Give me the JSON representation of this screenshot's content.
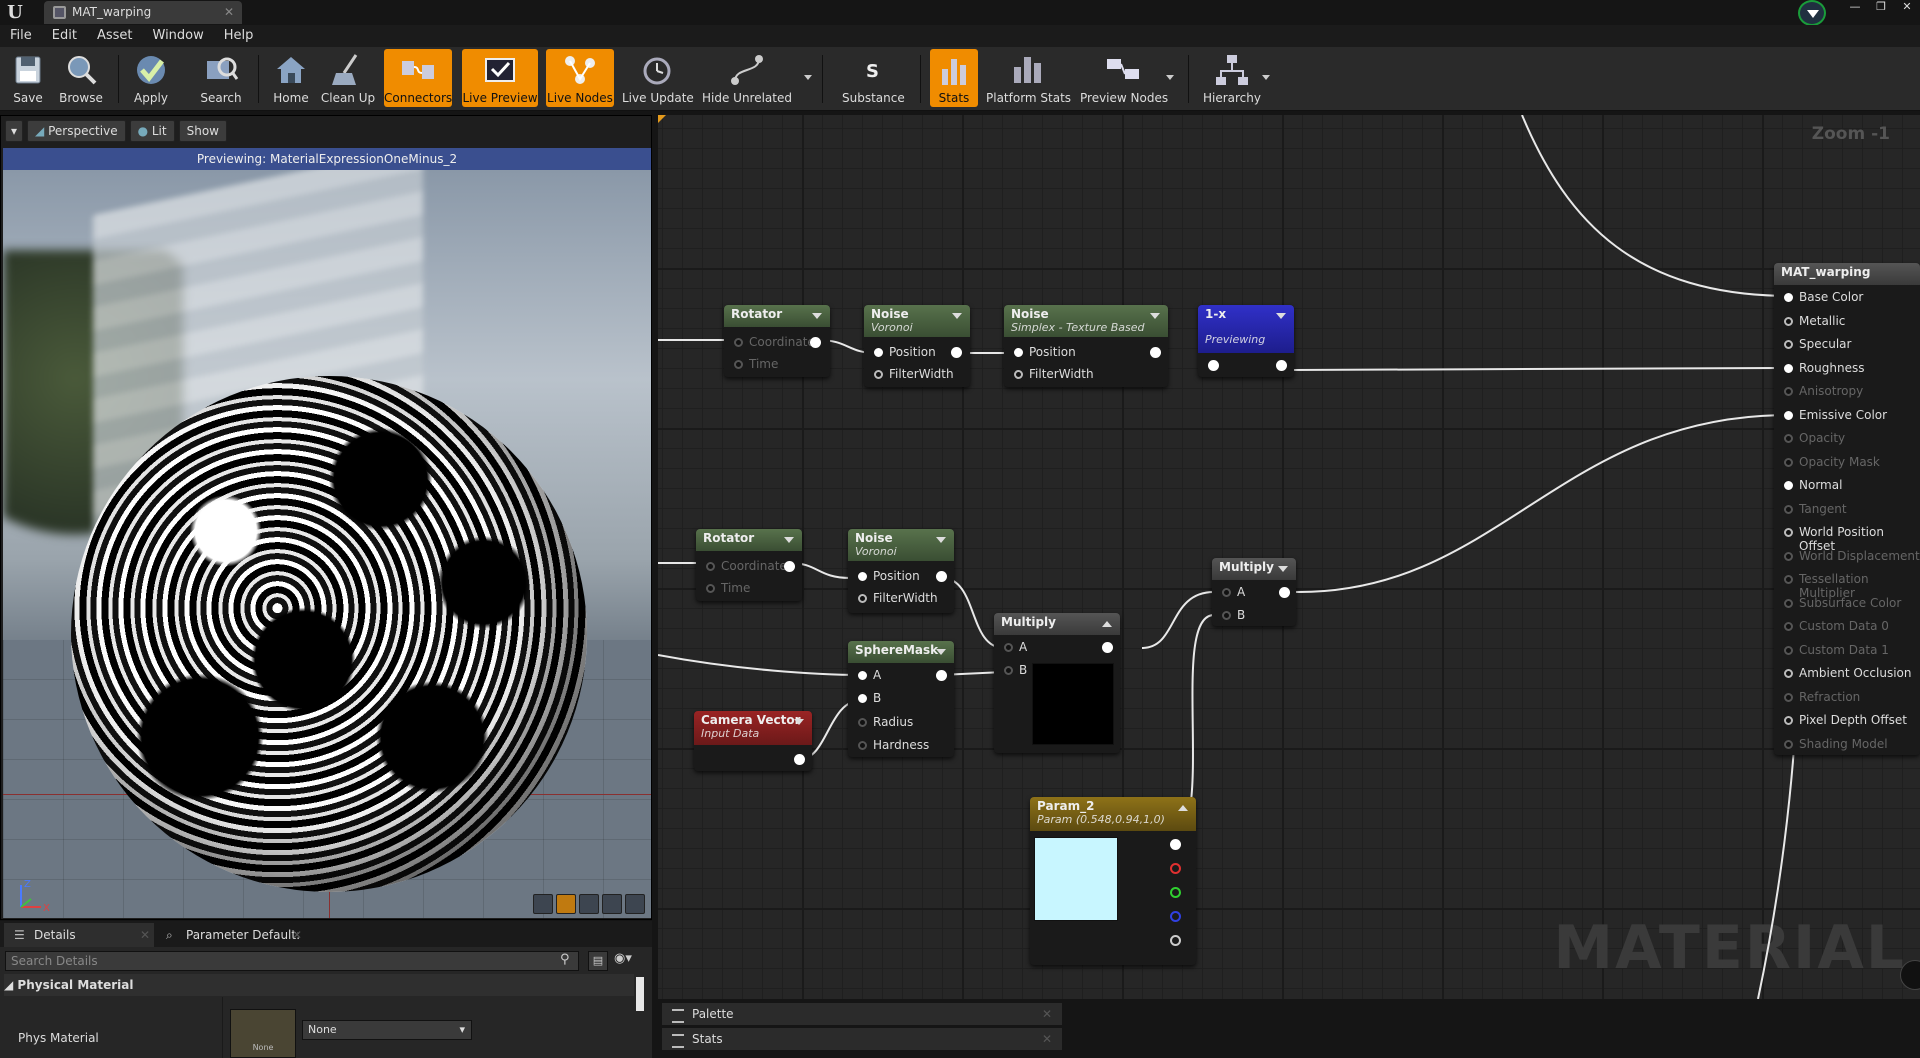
{
  "window": {
    "tab_title": "MAT_warping",
    "logo": "U"
  },
  "menu": [
    "File",
    "Edit",
    "Asset",
    "Window",
    "Help"
  ],
  "toolbar": [
    {
      "label": "Save",
      "icon": "save-icon",
      "active": false
    },
    {
      "label": "Browse",
      "icon": "browse-icon",
      "active": false
    },
    {
      "label": "Apply",
      "icon": "apply-icon",
      "active": false
    },
    {
      "label": "Search",
      "icon": "search-icon",
      "active": false
    },
    {
      "label": "Home",
      "icon": "home-icon",
      "active": false
    },
    {
      "label": "Clean Up",
      "icon": "clean-up-icon",
      "active": false
    },
    {
      "label": "Connectors",
      "icon": "connectors-icon",
      "active": true
    },
    {
      "label": "Live Preview",
      "icon": "live-preview-icon",
      "active": true
    },
    {
      "label": "Live Nodes",
      "icon": "live-nodes-icon",
      "active": true
    },
    {
      "label": "Live Update",
      "icon": "live-update-icon",
      "active": false
    },
    {
      "label": "Hide Unrelated",
      "icon": "hide-unrelated-icon",
      "active": false
    },
    {
      "label": "Substance",
      "icon": "substance-icon",
      "active": false
    },
    {
      "label": "Stats",
      "icon": "stats-icon",
      "active": true
    },
    {
      "label": "Platform Stats",
      "icon": "platform-stats-icon",
      "active": false
    },
    {
      "label": "Preview Nodes",
      "icon": "preview-nodes-icon",
      "active": false
    },
    {
      "label": "Hierarchy",
      "icon": "hierarchy-icon",
      "active": false
    }
  ],
  "viewport": {
    "perspective": "Perspective",
    "lit": "Lit",
    "show": "Show",
    "previewing": "Previewing: MaterialExpressionOneMinus_2",
    "gizmo_z": "Z",
    "gizmo_x": "X"
  },
  "details": {
    "tab_details": "Details",
    "tab_params": "Parameter Default:",
    "search_placeholder": "Search Details",
    "section": "Physical Material",
    "row_label": "Phys Material",
    "thumb_label": "None",
    "dropdown_value": "None"
  },
  "graph": {
    "zoom": "Zoom -1",
    "watermark": "MATERIAL",
    "nodes": {
      "rotator1": {
        "title": "Rotator",
        "pins": [
          "Coordinate",
          "Time"
        ]
      },
      "noise1": {
        "title": "Noise",
        "sub": "Voronoi",
        "pins": [
          "Position",
          "FilterWidth"
        ]
      },
      "noise2": {
        "title": "Noise",
        "sub": "Simplex - Texture Based",
        "pins": [
          "Position",
          "FilterWidth"
        ]
      },
      "oneminus": {
        "title": "1-x",
        "sub": "Previewing"
      },
      "rotator2": {
        "title": "Rotator",
        "pins": [
          "Coordinate",
          "Time"
        ]
      },
      "noise3": {
        "title": "Noise",
        "sub": "Voronoi",
        "pins": [
          "Position",
          "FilterWidth"
        ]
      },
      "spheremask": {
        "title": "SphereMask",
        "pins": [
          "A",
          "B",
          "Radius",
          "Hardness"
        ]
      },
      "camera": {
        "title": "Camera Vector",
        "sub": "Input Data"
      },
      "multiply1": {
        "title": "Multiply",
        "pins": [
          "A",
          "B"
        ]
      },
      "multiply2": {
        "title": "Multiply",
        "pins": [
          "A",
          "B"
        ]
      },
      "param": {
        "title": "Param_2",
        "sub": "Param (0.548,0.94,1,0)",
        "color": "#c8f6ff"
      },
      "result": {
        "title": "MAT_warping",
        "pins": [
          {
            "label": "Base Color",
            "state": "on"
          },
          {
            "label": "Metallic",
            "state": "ring"
          },
          {
            "label": "Specular",
            "state": "ring"
          },
          {
            "label": "Roughness",
            "state": "on"
          },
          {
            "label": "Anisotropy",
            "state": "dim"
          },
          {
            "label": "Emissive Color",
            "state": "on"
          },
          {
            "label": "Opacity",
            "state": "dim"
          },
          {
            "label": "Opacity Mask",
            "state": "dim"
          },
          {
            "label": "Normal",
            "state": "on"
          },
          {
            "label": "Tangent",
            "state": "dim"
          },
          {
            "label": "World Position Offset",
            "state": "ring"
          },
          {
            "label": "World Displacement",
            "state": "dim"
          },
          {
            "label": "Tessellation Multiplier",
            "state": "dim"
          },
          {
            "label": "Subsurface Color",
            "state": "dim"
          },
          {
            "label": "Custom Data 0",
            "state": "dim"
          },
          {
            "label": "Custom Data 1",
            "state": "dim"
          },
          {
            "label": "Ambient Occlusion",
            "state": "ring"
          },
          {
            "label": "Refraction",
            "state": "dim"
          },
          {
            "label": "Pixel Depth Offset",
            "state": "ring"
          },
          {
            "label": "Shading Model",
            "state": "dim"
          }
        ]
      }
    }
  },
  "bottom_tabs": [
    "Palette",
    "Stats"
  ]
}
